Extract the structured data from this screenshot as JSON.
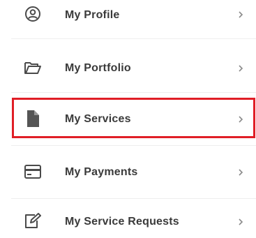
{
  "menu": {
    "items": [
      {
        "label": "My Profile",
        "icon": "profile-icon"
      },
      {
        "label": "My Portfolio",
        "icon": "folder-icon"
      },
      {
        "label": "My Services",
        "icon": "document-icon",
        "selected": true
      },
      {
        "label": "My Payments",
        "icon": "card-icon"
      },
      {
        "label": "My Service Requests",
        "icon": "edit-icon"
      }
    ],
    "chevron_glyph": ">"
  },
  "colors": {
    "label_text": "#3a3a3a",
    "icon": "#4a4a4a",
    "chevron": "#8a8a8a",
    "highlight_border": "#e01e26",
    "divider": "#eeeeee",
    "background": "#ffffff"
  }
}
